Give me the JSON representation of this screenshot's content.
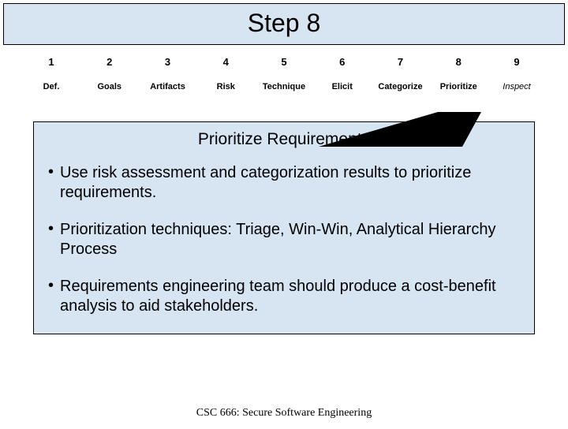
{
  "title": "Step 8",
  "steps": [
    {
      "num": "1",
      "label": "Def."
    },
    {
      "num": "2",
      "label": "Goals"
    },
    {
      "num": "3",
      "label": "Artifacts"
    },
    {
      "num": "4",
      "label": "Risk"
    },
    {
      "num": "5",
      "label": "Technique"
    },
    {
      "num": "6",
      "label": "Elicit"
    },
    {
      "num": "7",
      "label": "Categorize"
    },
    {
      "num": "8",
      "label": "Prioritize"
    },
    {
      "num": "9",
      "label": "Inspect",
      "italic": true
    }
  ],
  "content": {
    "heading": "Prioritize Requirements",
    "bullets": [
      "Use risk assessment and categorization results to prioritize requirements.",
      "Prioritization techniques: Triage, Win-Win, Analytical Hierarchy Process",
      "Requirements engineering team should produce a cost-benefit analysis to aid stakeholders."
    ]
  },
  "footer": "CSC 666: Secure Software Engineering"
}
